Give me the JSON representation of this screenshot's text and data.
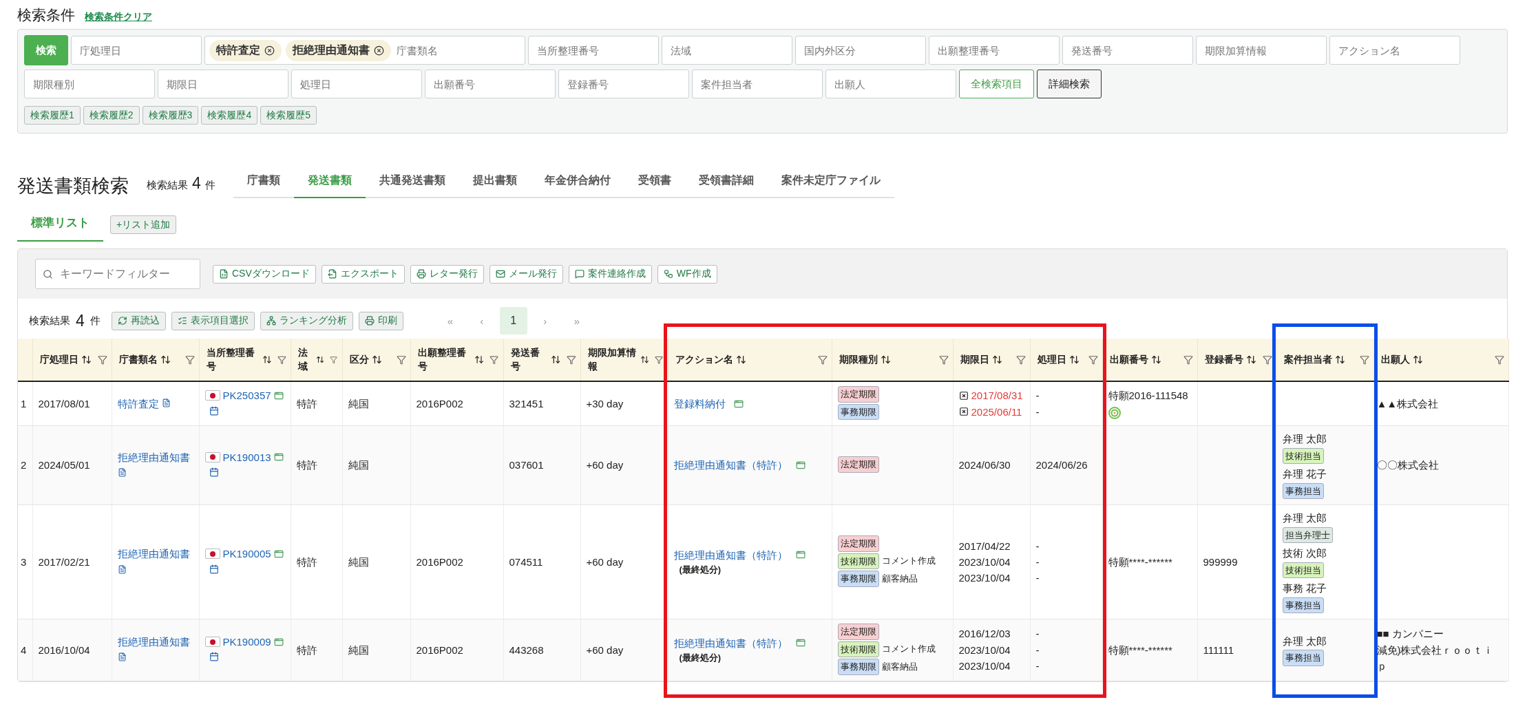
{
  "search": {
    "title": "検索条件",
    "clear_link": "検索条件クリア",
    "items": [
      {
        "kind": "submit",
        "label": "検索"
      },
      {
        "kind": "field",
        "placeholder": "庁処理日"
      },
      {
        "kind": "chips",
        "chips": [
          "特許査定",
          "拒絶理由通知書"
        ],
        "placeholder": "庁書類名"
      },
      {
        "kind": "field",
        "placeholder": "当所整理番号"
      },
      {
        "kind": "field",
        "placeholder": "法域"
      },
      {
        "kind": "field",
        "placeholder": "国内外区分"
      },
      {
        "kind": "field",
        "placeholder": "出願整理番号"
      },
      {
        "kind": "field",
        "placeholder": "発送番号"
      },
      {
        "kind": "field",
        "placeholder": "期限加算情報"
      },
      {
        "kind": "field",
        "placeholder": "アクション名"
      },
      {
        "kind": "field",
        "placeholder": "期限種別"
      },
      {
        "kind": "field",
        "placeholder": "期限日"
      },
      {
        "kind": "field",
        "placeholder": "処理日"
      },
      {
        "kind": "field",
        "placeholder": "出願番号"
      },
      {
        "kind": "field",
        "placeholder": "登録番号"
      },
      {
        "kind": "field",
        "placeholder": "案件担当者"
      },
      {
        "kind": "field",
        "placeholder": "出願人"
      },
      {
        "kind": "all_fields",
        "label": "全検索項目"
      },
      {
        "kind": "advanced",
        "label": "詳細検索"
      }
    ],
    "history": [
      "検索履歴1",
      "検索履歴2",
      "検索履歴3",
      "検索履歴4",
      "検索履歴5"
    ]
  },
  "page": {
    "title": "発送書類検索",
    "result_label": "検索結果",
    "result_count": "4",
    "result_unit": "件"
  },
  "tabs": [
    {
      "label": "庁書類",
      "selected": false
    },
    {
      "label": "発送書類",
      "selected": true
    },
    {
      "label": "共通発送書類",
      "selected": false
    },
    {
      "label": "提出書類",
      "selected": false
    },
    {
      "label": "年金併合納付",
      "selected": false
    },
    {
      "label": "受領書",
      "selected": false
    },
    {
      "label": "受領書詳細",
      "selected": false
    },
    {
      "label": "案件未定庁ファイル",
      "selected": false
    }
  ],
  "list_tabs": [
    {
      "label": "標準リスト",
      "selected": true
    }
  ],
  "add_list": "+リスト追加",
  "toolbar": {
    "filter_placeholder": "キーワードフィルター",
    "actions": [
      {
        "kind": "csv",
        "label": "CSVダウンロード"
      },
      {
        "kind": "export",
        "label": "エクスポート"
      },
      {
        "kind": "letter",
        "label": "レター発行"
      },
      {
        "kind": "mail",
        "label": "メール発行"
      },
      {
        "kind": "message",
        "label": "案件連絡作成"
      },
      {
        "kind": "workflow",
        "label": "WF作成"
      }
    ]
  },
  "results": {
    "label": "検索結果",
    "count": "4",
    "unit": "件",
    "actions": [
      {
        "kind": "reload",
        "label": "再読込"
      },
      {
        "kind": "columns",
        "label": "表示項目選択"
      },
      {
        "kind": "ranking",
        "label": "ランキング分析"
      },
      {
        "kind": "print",
        "label": "印刷"
      }
    ],
    "pagination": [
      {
        "label": "«",
        "selected": false
      },
      {
        "label": "‹",
        "selected": false
      },
      {
        "label": "1",
        "selected": true
      },
      {
        "label": "›",
        "selected": false
      },
      {
        "label": "»",
        "selected": false
      }
    ]
  },
  "table": {
    "columns": [
      {
        "label": "庁処理日"
      },
      {
        "label": "庁書類名"
      },
      {
        "label": "当所整理番号"
      },
      {
        "label": "法域"
      },
      {
        "label": "区分"
      },
      {
        "label": "出願整理番号"
      },
      {
        "label": "発送番号"
      },
      {
        "label": "期限加算情報"
      },
      {
        "label": "アクション名",
        "color": "#e8141c"
      },
      {
        "label": "期限種別",
        "color": "#e8141c"
      },
      {
        "label": "期限日",
        "color": "#e8141c"
      },
      {
        "label": "処理日",
        "color": "#e8141c"
      },
      {
        "label": "出願番号"
      },
      {
        "label": "登録番号"
      },
      {
        "label": "案件担当者",
        "color": "#0a4ee8"
      },
      {
        "label": "出願人"
      }
    ],
    "rows": [
      {
        "no": "1",
        "office_date": "2017/08/01",
        "doc_name": "特許査定",
        "ref_no": "PK250357",
        "law": "特許",
        "division": "純国",
        "app_ref": "2016P002",
        "send_no": "321451",
        "extension": "+30 day",
        "action": "登録料納付",
        "deadlines": [
          {
            "type": "法定期限",
            "color": "#f8cfd1",
            "date": "2017/08/31",
            "overdue": true,
            "processed": "-"
          },
          {
            "type": "事務期限",
            "color": "#c9def6",
            "date": "2025/06/11",
            "overdue": true,
            "processed": "-"
          }
        ],
        "app_no": "特願2016-111548",
        "app_no_badge": true,
        "staff": [],
        "applicant": [
          "▲▲株式会社"
        ]
      },
      {
        "no": "2",
        "office_date": "2024/05/01",
        "doc_name": "拒絶理由通知書",
        "ref_no": "PK190013",
        "law": "特許",
        "division": "純国",
        "send_no": "037601",
        "extension": "+60 day",
        "action": "拒絶理由通知書（特許）",
        "deadlines": [
          {
            "type": "法定期限",
            "color": "#f8cfd1",
            "date": "2024/06/30",
            "overdue": false,
            "processed": "2024/06/26"
          }
        ],
        "app_no_badge": false,
        "staff": [
          {
            "name": "弁理 太郎",
            "role": "技術担当",
            "color": "#d7f4bb"
          },
          {
            "name": "弁理 花子",
            "role": "事務担当",
            "color": "#c9def6"
          }
        ],
        "applicant": [
          "〇〇株式会社"
        ]
      },
      {
        "no": "3",
        "office_date": "2017/02/21",
        "doc_name": "拒絶理由通知書",
        "ref_no": "PK190005",
        "law": "特許",
        "division": "純国",
        "app_ref": "2016P002",
        "send_no": "074511",
        "extension": "+60 day",
        "action": "拒絶理由通知書（特許）",
        "action_note": "(最終処分)",
        "deadlines": [
          {
            "type": "法定期限",
            "color": "#f8cfd1",
            "date": "2017/04/22",
            "overdue": false,
            "processed": "-"
          },
          {
            "type": "技術期限",
            "color": "#d7f4bb",
            "note": "コメント作成",
            "date": "2023/10/04",
            "overdue": false,
            "processed": "-"
          },
          {
            "type": "事務期限",
            "color": "#c9def6",
            "note": "顧客納品",
            "date": "2023/10/04",
            "overdue": false,
            "processed": "-"
          }
        ],
        "app_no": "特願****-******",
        "app_no_badge": false,
        "reg_no": "999999",
        "staff": [
          {
            "name": "弁理 太郎",
            "role": "担当弁理士",
            "color": "#dde9e1"
          },
          {
            "name": "技術 次郎",
            "role": "技術担当",
            "color": "#d7f4bb"
          },
          {
            "name": "事務 花子",
            "role": "事務担当",
            "color": "#c9def6"
          }
        ],
        "applicant": []
      },
      {
        "no": "4",
        "office_date": "2016/10/04",
        "doc_name": "拒絶理由通知書",
        "ref_no": "PK190009",
        "law": "特許",
        "division": "純国",
        "app_ref": "2016P002",
        "send_no": "443268",
        "extension": "+60 day",
        "action": "拒絶理由通知書（特許）",
        "action_note": "(最終処分)",
        "deadlines": [
          {
            "type": "法定期限",
            "color": "#f8cfd1",
            "date": "2016/12/03",
            "overdue": false,
            "processed": "-"
          },
          {
            "type": "技術期限",
            "color": "#d7f4bb",
            "note": "コメント作成",
            "date": "2023/10/04",
            "overdue": false,
            "processed": "-"
          },
          {
            "type": "事務期限",
            "color": "#c9def6",
            "note": "顧客納品",
            "date": "2023/10/04",
            "overdue": false,
            "processed": "-"
          }
        ],
        "app_no": "特願****-******",
        "app_no_badge": false,
        "reg_no": "111111",
        "staff": [
          {
            "name": "弁理 太郎",
            "role": "事務担当",
            "color": "#c9def6"
          }
        ],
        "applicant": [
          "■■ カンパニー",
          "減免)株式会社ｒｏｏｔｉｐ"
        ]
      }
    ]
  }
}
